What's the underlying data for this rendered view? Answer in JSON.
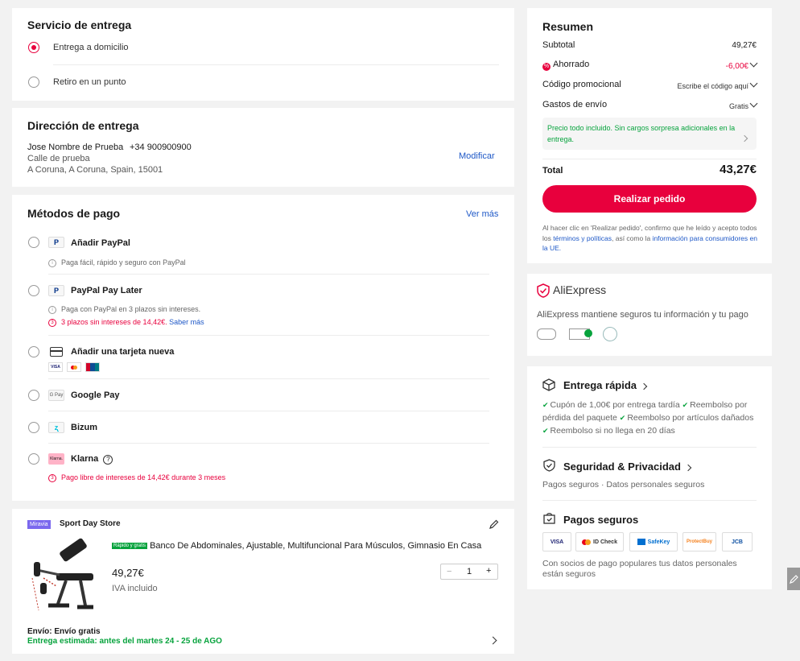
{
  "delivery": {
    "title": "Servicio de entrega",
    "options": [
      "Entrega a domicilio",
      "Retiro en un punto"
    ]
  },
  "address": {
    "title": "Dirección de entrega",
    "name": "Jose Nombre de Prueba",
    "phone": "+34 900900900",
    "street": "Calle de prueba",
    "city": "A Coruna, A Coruna, Spain, 15001",
    "edit_label": "Modificar"
  },
  "payment": {
    "title": "Métodos de pago",
    "more_label": "Ver más",
    "paypal": {
      "label": "Añadir PayPal",
      "note": "Paga fácil, rápido y seguro con PayPal"
    },
    "paylater": {
      "label": "PayPal Pay Later",
      "note": "Paga con PayPal en 3 plazos sin intereses.",
      "promo": "3 plazos sin intereses de 14,42€.",
      "promo_link": "Saber más"
    },
    "card": {
      "label": "Añadir una tarjeta nueva",
      "brands": [
        "VISA",
        "MC",
        "UP"
      ]
    },
    "gpay": {
      "label": "Google Pay",
      "icon_text": "G Pay"
    },
    "bizum": {
      "label": "Bizum"
    },
    "klarna": {
      "label": "Klarna",
      "icon_text": "Klarna.",
      "promo": "Pago libre de intereses de 14,42€ durante 3 meses"
    }
  },
  "store": {
    "badge": "Miravia",
    "name": "Sport Day Store",
    "product_tag": "Rápido y gratis",
    "product_title": "Banco De Abdominales, Ajustable, Multifuncional Para Músculos, Gimnasio En Casa",
    "price": "49,27€",
    "tax_note": "IVA incluido",
    "qty_minus": "−",
    "qty": "1",
    "qty_plus": "+",
    "shipping": "Envío: Envío gratis",
    "eta": "Entrega estimada: antes del martes 24 - 25 de AGO"
  },
  "summary": {
    "title": "Resumen",
    "subtotal_label": "Subtotal",
    "subtotal": "49,27€",
    "saved_label": "Ahorrado",
    "saved": "-6,00€",
    "promo_label": "Código promocional",
    "promo_value": "Escribe el código aquí",
    "shipping_label": "Gastos de envío",
    "shipping_value": "Gratis",
    "notice": "Precio todo incluido. Sin cargos sorpresa adicionales en la entrega.",
    "total_label": "Total",
    "total": "43,27€",
    "order_button": "Realizar pedido",
    "legal_1": "Al hacer clic en 'Realizar pedido', confirmo que he leído y acepto todos los",
    "legal_link_1": "términos y políticas",
    "legal_2": ", así como la",
    "legal_link_2": "información para consumidores en la UE."
  },
  "trust": {
    "brand": "AliExpress",
    "text": "AliExpress mantiene seguros tu información y tu pago"
  },
  "benefits": {
    "fast_title": "Entrega rápida",
    "fast_items": [
      "Cupón de 1,00€ por entrega tardía",
      "Reembolso por pérdida del paquete",
      "Reembolso por artículos dañados",
      "Reembolso si no llega en 20 días"
    ],
    "security_title": "Seguridad & Privacidad",
    "security_text": "Pagos seguros · Datos personales seguros",
    "payments_title": "Pagos seguros",
    "payment_brands": [
      "VISA",
      "ID Check",
      "SafeKey",
      "ProtectBuy",
      "JCB"
    ],
    "payments_text": "Con socios de pago populares tus datos personales están seguros"
  },
  "colors": {
    "accent": "#e8003d",
    "green": "#07a33d",
    "link": "#1e58c7",
    "background": "#f2f2f2"
  }
}
